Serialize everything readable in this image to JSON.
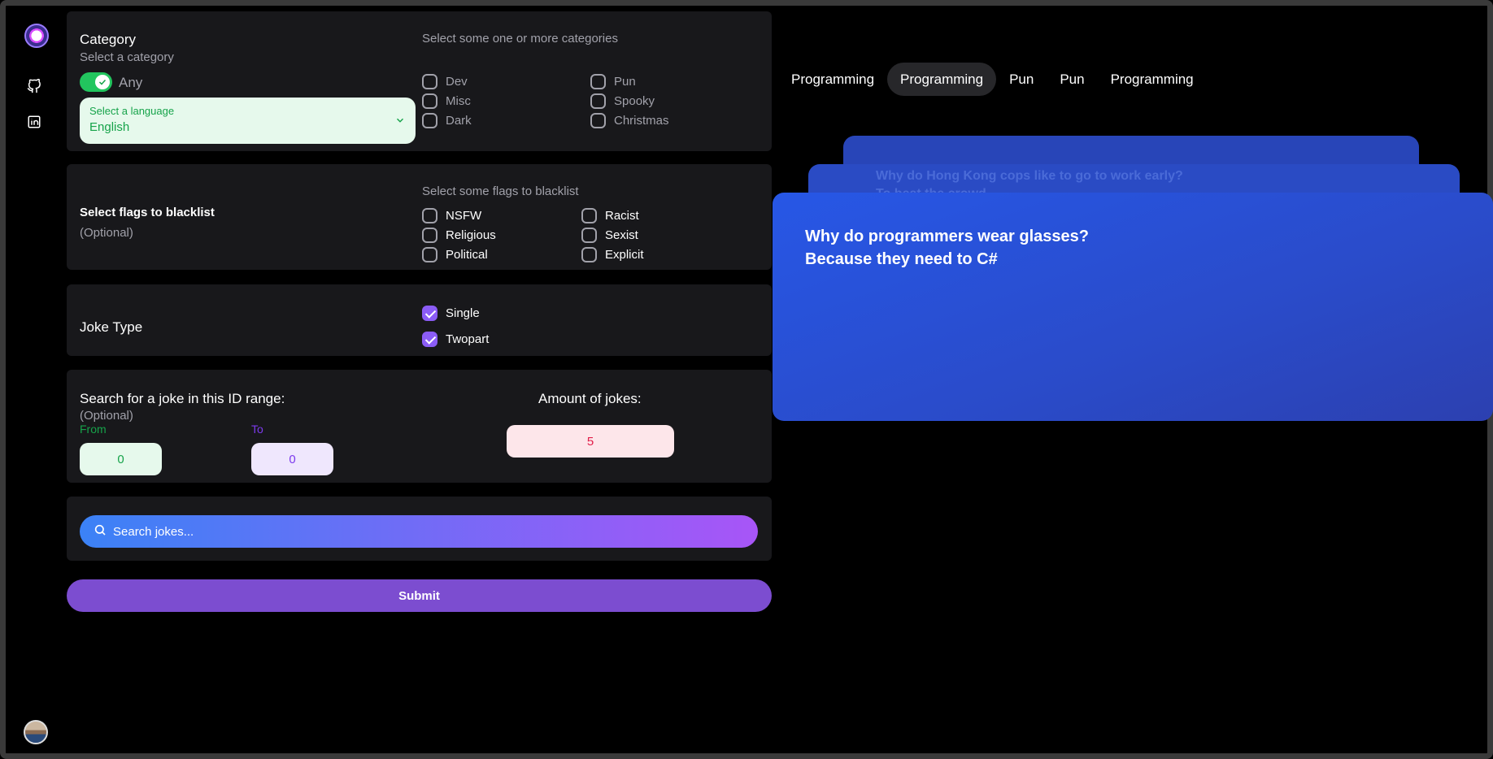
{
  "sidebar": {
    "icons": [
      "app-logo",
      "github-icon",
      "linkedin-icon",
      "user-avatar"
    ]
  },
  "category": {
    "title": "Category",
    "subtitle": "Select a category",
    "any_label": "Any",
    "language_label": "Select a language",
    "language_value": "English",
    "options_heading": "Select some one or more categories",
    "options": [
      "Dev",
      "Misc",
      "Dark",
      "Pun",
      "Spooky",
      "Christmas"
    ]
  },
  "flags": {
    "title": "Select flags to blacklist",
    "subtitle": "(Optional)",
    "options_heading": "Select some flags to blacklist",
    "options": [
      "NSFW",
      "Religious",
      "Political",
      "Racist",
      "Sexist",
      "Explicit"
    ]
  },
  "joke_type": {
    "title": "Joke Type",
    "options": [
      {
        "label": "Single",
        "checked": true
      },
      {
        "label": "Twopart",
        "checked": true
      }
    ]
  },
  "id_range": {
    "title": "Search for a joke in this ID range:",
    "subtitle": "(Optional)",
    "from_label": "From",
    "from_value": "0",
    "to_label": "To",
    "to_value": "0",
    "amount_label": "Amount of jokes:",
    "amount_value": "5"
  },
  "search": {
    "placeholder": "Search jokes..."
  },
  "submit_label": "Submit",
  "tabs": [
    {
      "label": "Programming",
      "active": false
    },
    {
      "label": "Programming",
      "active": true
    },
    {
      "label": "Pun",
      "active": false
    },
    {
      "label": "Pun",
      "active": false
    },
    {
      "label": "Programming",
      "active": false
    }
  ],
  "jokes": {
    "back": {
      "line1": "Why do Hong Kong cops like to go to work early?",
      "line2": "To beat the crowd."
    },
    "front": {
      "line1": "Why do programmers wear glasses?",
      "line2": "Because they need to C#"
    }
  },
  "colors": {
    "accent": "#8b5cf6",
    "toggle": "#22c55e",
    "card": "#18181b",
    "joke_card": "#2a4fd6"
  }
}
